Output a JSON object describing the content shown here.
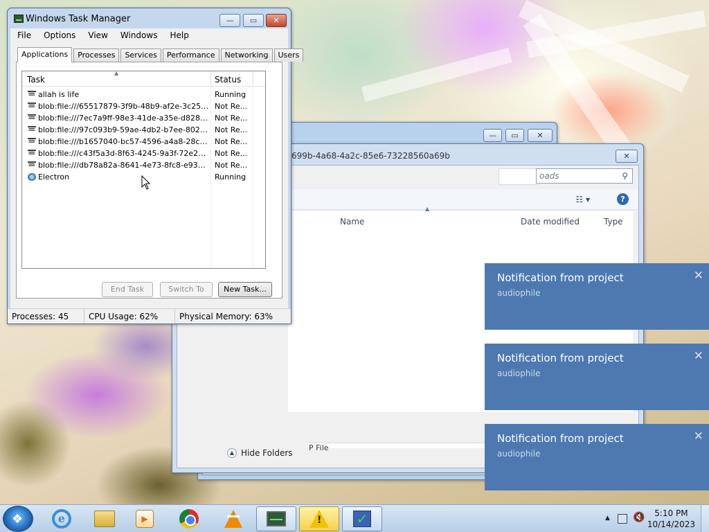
{
  "taskmgr": {
    "title": "Windows Task Manager",
    "menu": [
      "File",
      "Options",
      "View",
      "Windows",
      "Help"
    ],
    "tabs": [
      "Applications",
      "Processes",
      "Services",
      "Performance",
      "Networking",
      "Users"
    ],
    "active_tab": "Applications",
    "columns": {
      "task": "Task",
      "status": "Status"
    },
    "rows": [
      {
        "task": "allah is life",
        "status": "Running",
        "icon": "window-icon"
      },
      {
        "task": "blob:file:///65517879-3f9b-48b9-af2e-3c25a0f6...",
        "status": "Not Re...",
        "icon": "window-icon"
      },
      {
        "task": "blob:file:///7ec7a9ff-98e3-41de-a35e-d8283938...",
        "status": "Not Re...",
        "icon": "window-icon"
      },
      {
        "task": "blob:file:///97c093b9-59ae-4db2-b7ee-80275e8...",
        "status": "Not Re...",
        "icon": "window-icon"
      },
      {
        "task": "blob:file:///b1657040-bc57-4596-a4a8-28c0006...",
        "status": "Not Re...",
        "icon": "window-icon"
      },
      {
        "task": "blob:file:///c43f5a3d-8f63-4245-9a3f-72e2da81...",
        "status": "Not Re...",
        "icon": "window-icon"
      },
      {
        "task": "blob:file:///db78a82a-8641-4e73-8fc8-e93c539...",
        "status": "Not Re...",
        "icon": "window-icon"
      },
      {
        "task": "Electron",
        "status": "Running",
        "icon": "electron-icon"
      }
    ],
    "buttons": {
      "end_task": "End Task",
      "switch_to": "Switch To",
      "new_task": "New Task..."
    },
    "statusbar": {
      "processes": "Processes: 45",
      "cpu": "CPU Usage: 62%",
      "memory": "Physical Memory: 63%"
    }
  },
  "save_dialog": {
    "path_fragment": "699b-4a68-4a2c-85e6-73228560a69b",
    "search_placeholder": "oads",
    "columns": {
      "name": "Name",
      "date_modified": "Date modified",
      "type": "Type"
    },
    "save_as_type_fragment": "P File",
    "hide_folders": "Hide Folders"
  },
  "notifications": [
    {
      "title": "Notification from project",
      "body": "audiophile"
    },
    {
      "title": "Notification from project",
      "body": "audiophile"
    },
    {
      "title": "Notification from project",
      "body": "audiophile"
    }
  ],
  "taskbar": {
    "items": [
      "internet-explorer-icon",
      "windows-explorer-icon",
      "media-center-icon",
      "chrome-icon",
      "vlc-icon",
      "task-manager-icon",
      "warning-icon",
      "check-icon"
    ],
    "clock": {
      "time": "5:10 PM",
      "date": "10/14/2023"
    }
  },
  "colors": {
    "notification_bg": "#4e79b0",
    "window_frame": "#c4d7ec",
    "taskbar": "#b8cfe6"
  }
}
